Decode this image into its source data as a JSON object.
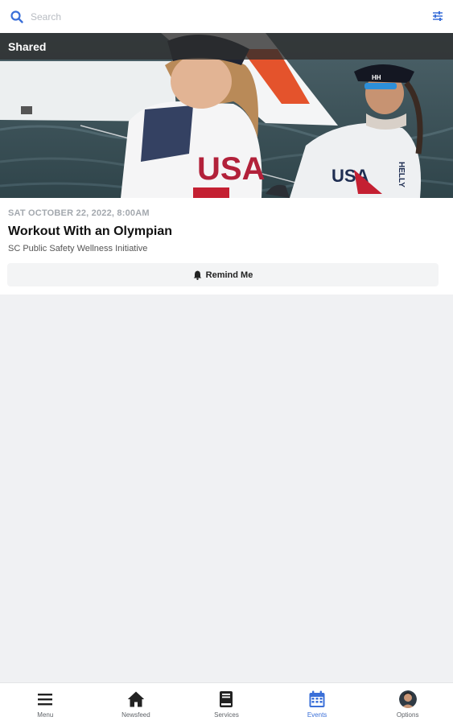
{
  "search": {
    "placeholder": "Search"
  },
  "header": {
    "filter_icon": "sliders-icon"
  },
  "event_card": {
    "badge": "Shared",
    "date": "SAT OCTOBER 22, 2022, 8:00AM",
    "title": "Workout With an Olympian",
    "organization": "SC Public Safety Wellness Initiative",
    "remind_label": "Remind Me",
    "remind_icon": "bell-icon",
    "image_text": {
      "usa_left": "USA",
      "usa_right": "USA",
      "cap_logo": "HH",
      "sleeve": "HELLY"
    }
  },
  "nav": {
    "items": [
      {
        "label": "Menu",
        "icon": "hamburger-icon"
      },
      {
        "label": "Newsfeed",
        "icon": "home-icon"
      },
      {
        "label": "Services",
        "icon": "book-icon"
      },
      {
        "label": "Events",
        "icon": "calendar-icon"
      },
      {
        "label": "Options",
        "icon": "avatar"
      }
    ],
    "active": "Events"
  },
  "colors": {
    "accent": "#3a6fd8",
    "background": "#f0f1f3"
  }
}
